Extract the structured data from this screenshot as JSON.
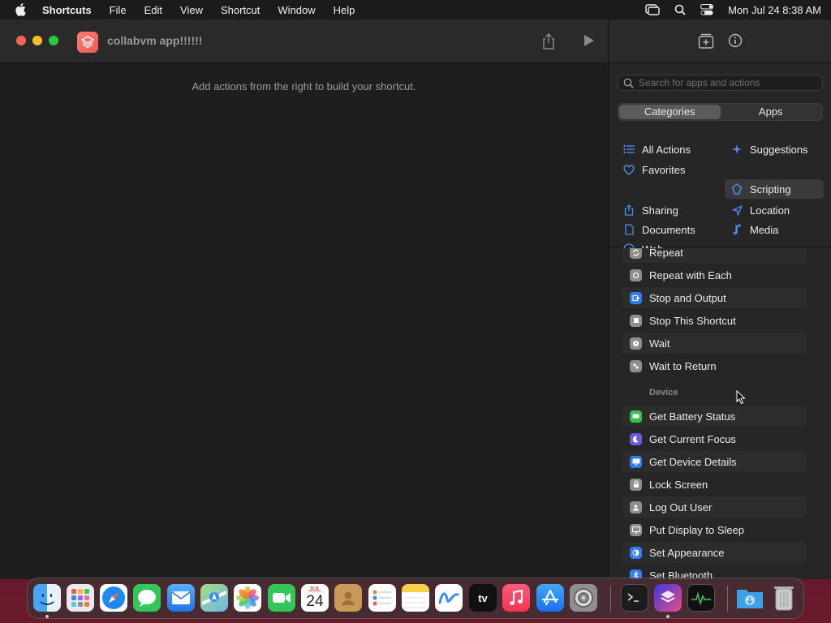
{
  "menubar": {
    "app_name": "Shortcuts",
    "items": [
      "File",
      "Edit",
      "View",
      "Shortcut",
      "Window",
      "Help"
    ],
    "clock": "Mon Jul 24  8:38 AM",
    "icons": [
      "apple-icon",
      "screen-mirroring-icon",
      "search-icon",
      "control-center-icon"
    ]
  },
  "window": {
    "title": "collabvm app!!!!!!",
    "editor_hint": "Add actions from the right to build your shortcut."
  },
  "sidebar": {
    "search_placeholder": "Search for apps and actions",
    "segments": [
      {
        "label": "Categories",
        "active": true
      },
      {
        "label": "Apps",
        "active": false
      }
    ],
    "categories": [
      {
        "label": "All Actions",
        "icon": "list-icon"
      },
      {
        "label": "Suggestions",
        "icon": "sparkle-icon"
      },
      {
        "label": "Favorites",
        "icon": "heart-icon"
      },
      {
        "label": "Scripting",
        "icon": "scripting-icon",
        "selected": true
      },
      {
        "label": "Sharing",
        "icon": "share-icon"
      },
      {
        "label": "Location",
        "icon": "location-arrow-icon"
      },
      {
        "label": "Documents",
        "icon": "document-icon"
      },
      {
        "label": "Media",
        "icon": "music-note-icon"
      },
      {
        "label": "Web",
        "icon": "compass-icon"
      }
    ],
    "actions": [
      {
        "label": "Repeat",
        "icon": "repeat-icon",
        "color": "#8e8e8e"
      },
      {
        "label": "Repeat with Each",
        "icon": "repeat-each-icon",
        "color": "#8e8e8e"
      },
      {
        "label": "Stop and Output",
        "icon": "stop-output-icon",
        "color": "#2f7cf6"
      },
      {
        "label": "Stop This Shortcut",
        "icon": "stop-icon",
        "color": "#8e8e8e"
      },
      {
        "label": "Wait",
        "icon": "clock-icon",
        "color": "#8e8e8e"
      },
      {
        "label": "Wait to Return",
        "icon": "wait-return-icon",
        "color": "#8e8e8e"
      }
    ],
    "device_section": "Device",
    "device_actions": [
      {
        "label": "Get Battery Status",
        "icon": "battery-icon",
        "color": "#30c44f"
      },
      {
        "label": "Get Current Focus",
        "icon": "moon-icon",
        "color": "#6a5ae0"
      },
      {
        "label": "Get Device Details",
        "icon": "monitor-icon",
        "color": "#2f7cf6"
      },
      {
        "label": "Lock Screen",
        "icon": "lock-icon",
        "color": "#8e8e8e"
      },
      {
        "label": "Log Out User",
        "icon": "logout-icon",
        "color": "#8e8e8e"
      },
      {
        "label": "Put Display to Sleep",
        "icon": "display-sleep-icon",
        "color": "#8e8e8e"
      },
      {
        "label": "Set Appearance",
        "icon": "appearance-icon",
        "color": "#2f7cf6"
      },
      {
        "label": "Set Bluetooth",
        "icon": "bluetooth-icon",
        "color": "#2f7cf6"
      }
    ]
  },
  "dock": {
    "apps": [
      {
        "name": "finder-icon",
        "running": true
      },
      {
        "name": "launchpad-icon"
      },
      {
        "name": "safari-icon"
      },
      {
        "name": "messages-icon"
      },
      {
        "name": "mail-icon"
      },
      {
        "name": "maps-icon"
      },
      {
        "name": "photos-icon"
      },
      {
        "name": "facetime-icon"
      },
      {
        "name": "calendar-icon"
      },
      {
        "name": "contacts-icon"
      },
      {
        "name": "reminders-icon"
      },
      {
        "name": "notes-icon"
      },
      {
        "name": "freeform-icon"
      },
      {
        "name": "apple-tv-icon"
      },
      {
        "name": "music-icon"
      },
      {
        "name": "app-store-icon"
      },
      {
        "name": "system-settings-icon"
      },
      {
        "name": "terminal-icon"
      },
      {
        "name": "shortcuts-icon",
        "running": true
      },
      {
        "name": "activity-monitor-icon"
      },
      {
        "name": "downloads-folder-icon"
      },
      {
        "name": "trash-icon"
      }
    ],
    "calendar_month": "JUL",
    "calendar_day": "24",
    "tv_label": "tv"
  }
}
